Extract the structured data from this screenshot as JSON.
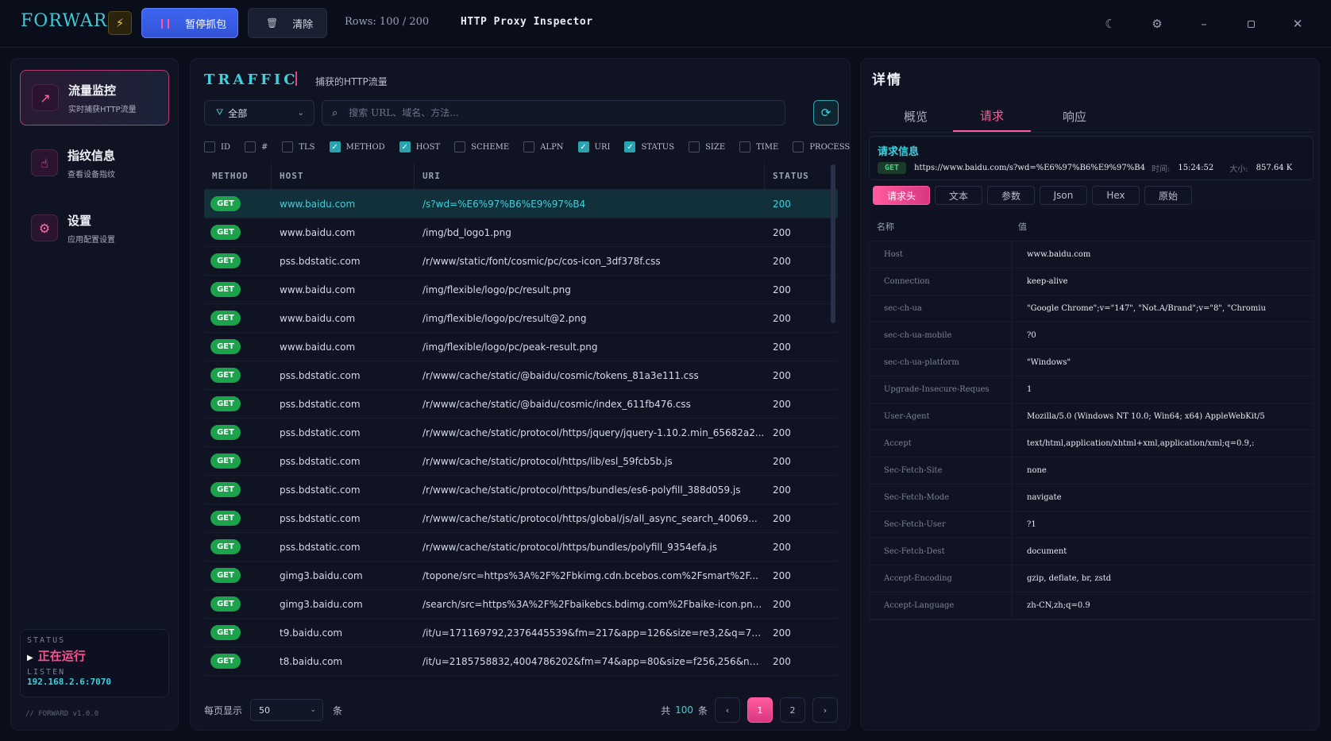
{
  "app": {
    "logo": "FORWARD",
    "pause_label": "暂停抓包",
    "clear_label": "清除",
    "rows_label": "Rows: 100 / 200",
    "title": "HTTP Proxy Inspector"
  },
  "sidebar": {
    "items": [
      {
        "title": "流量监控",
        "sub": "实时捕获HTTP流量",
        "icon": "trending-up-icon"
      },
      {
        "title": "指纹信息",
        "sub": "查看设备指纹",
        "icon": "fingerprint-icon"
      },
      {
        "title": "设置",
        "sub": "应用配置设置",
        "icon": "gear-icon"
      }
    ],
    "status_label": "STATUS",
    "status_value": "正在运行",
    "listen_label": "LISTEN",
    "listen_value": "192.168.2.6:7070",
    "version": "// FORWARD v1.0.0"
  },
  "traffic": {
    "title": "TRAFFIC",
    "subtitle": "捕获的HTTP流量",
    "filter_value": "全部",
    "search_placeholder": "搜索 URL、域名、方法...",
    "columns": [
      {
        "label": "ID",
        "checked": false
      },
      {
        "label": "#",
        "checked": false
      },
      {
        "label": "TLS",
        "checked": false
      },
      {
        "label": "METHOD",
        "checked": true
      },
      {
        "label": "HOST",
        "checked": true
      },
      {
        "label": "SCHEME",
        "checked": false
      },
      {
        "label": "ALPN",
        "checked": false
      },
      {
        "label": "URI",
        "checked": true
      },
      {
        "label": "STATUS",
        "checked": true
      },
      {
        "label": "SIZE",
        "checked": false
      },
      {
        "label": "TIME",
        "checked": false
      },
      {
        "label": "PROCESS",
        "checked": false
      }
    ],
    "headers": [
      "METHOD",
      "HOST",
      "URI",
      "STATUS"
    ],
    "rows": [
      {
        "method": "GET",
        "host": "www.baidu.com",
        "uri": "/s?wd=%E6%97%B6%E9%97%B4",
        "status": "200"
      },
      {
        "method": "GET",
        "host": "www.baidu.com",
        "uri": "/img/bd_logo1.png",
        "status": "200"
      },
      {
        "method": "GET",
        "host": "pss.bdstatic.com",
        "uri": "/r/www/static/font/cosmic/pc/cos-icon_3df378f.css",
        "status": "200"
      },
      {
        "method": "GET",
        "host": "www.baidu.com",
        "uri": "/img/flexible/logo/pc/result.png",
        "status": "200"
      },
      {
        "method": "GET",
        "host": "www.baidu.com",
        "uri": "/img/flexible/logo/pc/result@2.png",
        "status": "200"
      },
      {
        "method": "GET",
        "host": "www.baidu.com",
        "uri": "/img/flexible/logo/pc/peak-result.png",
        "status": "200"
      },
      {
        "method": "GET",
        "host": "pss.bdstatic.com",
        "uri": "/r/www/cache/static/@baidu/cosmic/tokens_81a3e111.css",
        "status": "200"
      },
      {
        "method": "GET",
        "host": "pss.bdstatic.com",
        "uri": "/r/www/cache/static/@baidu/cosmic/index_611fb476.css",
        "status": "200"
      },
      {
        "method": "GET",
        "host": "pss.bdstatic.com",
        "uri": "/r/www/cache/static/protocol/https/jquery/jquery-1.10.2.min_65682a2...",
        "status": "200"
      },
      {
        "method": "GET",
        "host": "pss.bdstatic.com",
        "uri": "/r/www/cache/static/protocol/https/lib/esl_59fcb5b.js",
        "status": "200"
      },
      {
        "method": "GET",
        "host": "pss.bdstatic.com",
        "uri": "/r/www/cache/static/protocol/https/bundles/es6-polyfill_388d059.js",
        "status": "200"
      },
      {
        "method": "GET",
        "host": "pss.bdstatic.com",
        "uri": "/r/www/cache/static/protocol/https/global/js/all_async_search_40069...",
        "status": "200"
      },
      {
        "method": "GET",
        "host": "pss.bdstatic.com",
        "uri": "/r/www/cache/static/protocol/https/bundles/polyfill_9354efa.js",
        "status": "200"
      },
      {
        "method": "GET",
        "host": "gimg3.baidu.com",
        "uri": "/topone/src=https%3A%2F%2Fbkimg.cdn.bcebos.com%2Fsmart%2F...",
        "status": "200"
      },
      {
        "method": "GET",
        "host": "gimg3.baidu.com",
        "uri": "/search/src=https%3A%2F%2Fbaikebcs.bdimg.com%2Fbaike-icon.pn...",
        "status": "200"
      },
      {
        "method": "GET",
        "host": "t9.baidu.com",
        "uri": "/it/u=171169792,2376445539&fm=217&app=126&size=re3,2&q=75...",
        "status": "200"
      },
      {
        "method": "GET",
        "host": "t8.baidu.com",
        "uri": "/it/u=2185758832,4004786202&fm=74&app=80&size=f256,256&n=0...",
        "status": "200"
      }
    ],
    "per_page_label": "每页显示",
    "per_page_value": "50",
    "per_page_unit": "条",
    "total_prefix": "共",
    "total_value": "100",
    "total_suffix": "条",
    "pages": [
      "1",
      "2"
    ],
    "prev": "‹",
    "next": "›"
  },
  "detail": {
    "title": "详情",
    "tabs": [
      "概览",
      "请求",
      "响应"
    ],
    "req_info_title": "请求信息",
    "method": "GET",
    "url": "https://www.baidu.com/s?wd=%E6%97%B6%E9%97%B4",
    "time_label": "时间:",
    "time_value": "15:24:52",
    "size_label": "大小:",
    "size_value": "857.64 K",
    "subtabs": [
      "请求头",
      "文本",
      "参数",
      "Json",
      "Hex",
      "原始"
    ],
    "header_col_name": "名称",
    "header_col_value": "值",
    "headers": [
      {
        "k": "Host",
        "v": "www.baidu.com"
      },
      {
        "k": "Connection",
        "v": "keep-alive"
      },
      {
        "k": "sec-ch-ua",
        "v": "\"Google Chrome\";v=\"147\", \"Not.A/Brand\";v=\"8\", \"Chromiu"
      },
      {
        "k": "sec-ch-ua-mobile",
        "v": "?0"
      },
      {
        "k": "sec-ch-ua-platform",
        "v": "\"Windows\""
      },
      {
        "k": "Upgrade-Insecure-Reques",
        "v": "1"
      },
      {
        "k": "User-Agent",
        "v": "Mozilla/5.0 (Windows NT 10.0; Win64; x64) AppleWebKit/5"
      },
      {
        "k": "Accept",
        "v": "text/html,application/xhtml+xml,application/xml;q=0.9,:"
      },
      {
        "k": "Sec-Fetch-Site",
        "v": "none"
      },
      {
        "k": "Sec-Fetch-Mode",
        "v": "navigate"
      },
      {
        "k": "Sec-Fetch-User",
        "v": "?1"
      },
      {
        "k": "Sec-Fetch-Dest",
        "v": "document"
      },
      {
        "k": "Accept-Encoding",
        "v": "gzip, deflate, br, zstd"
      },
      {
        "k": "Accept-Language",
        "v": "zh-CN,zh;q=0.9"
      }
    ]
  }
}
